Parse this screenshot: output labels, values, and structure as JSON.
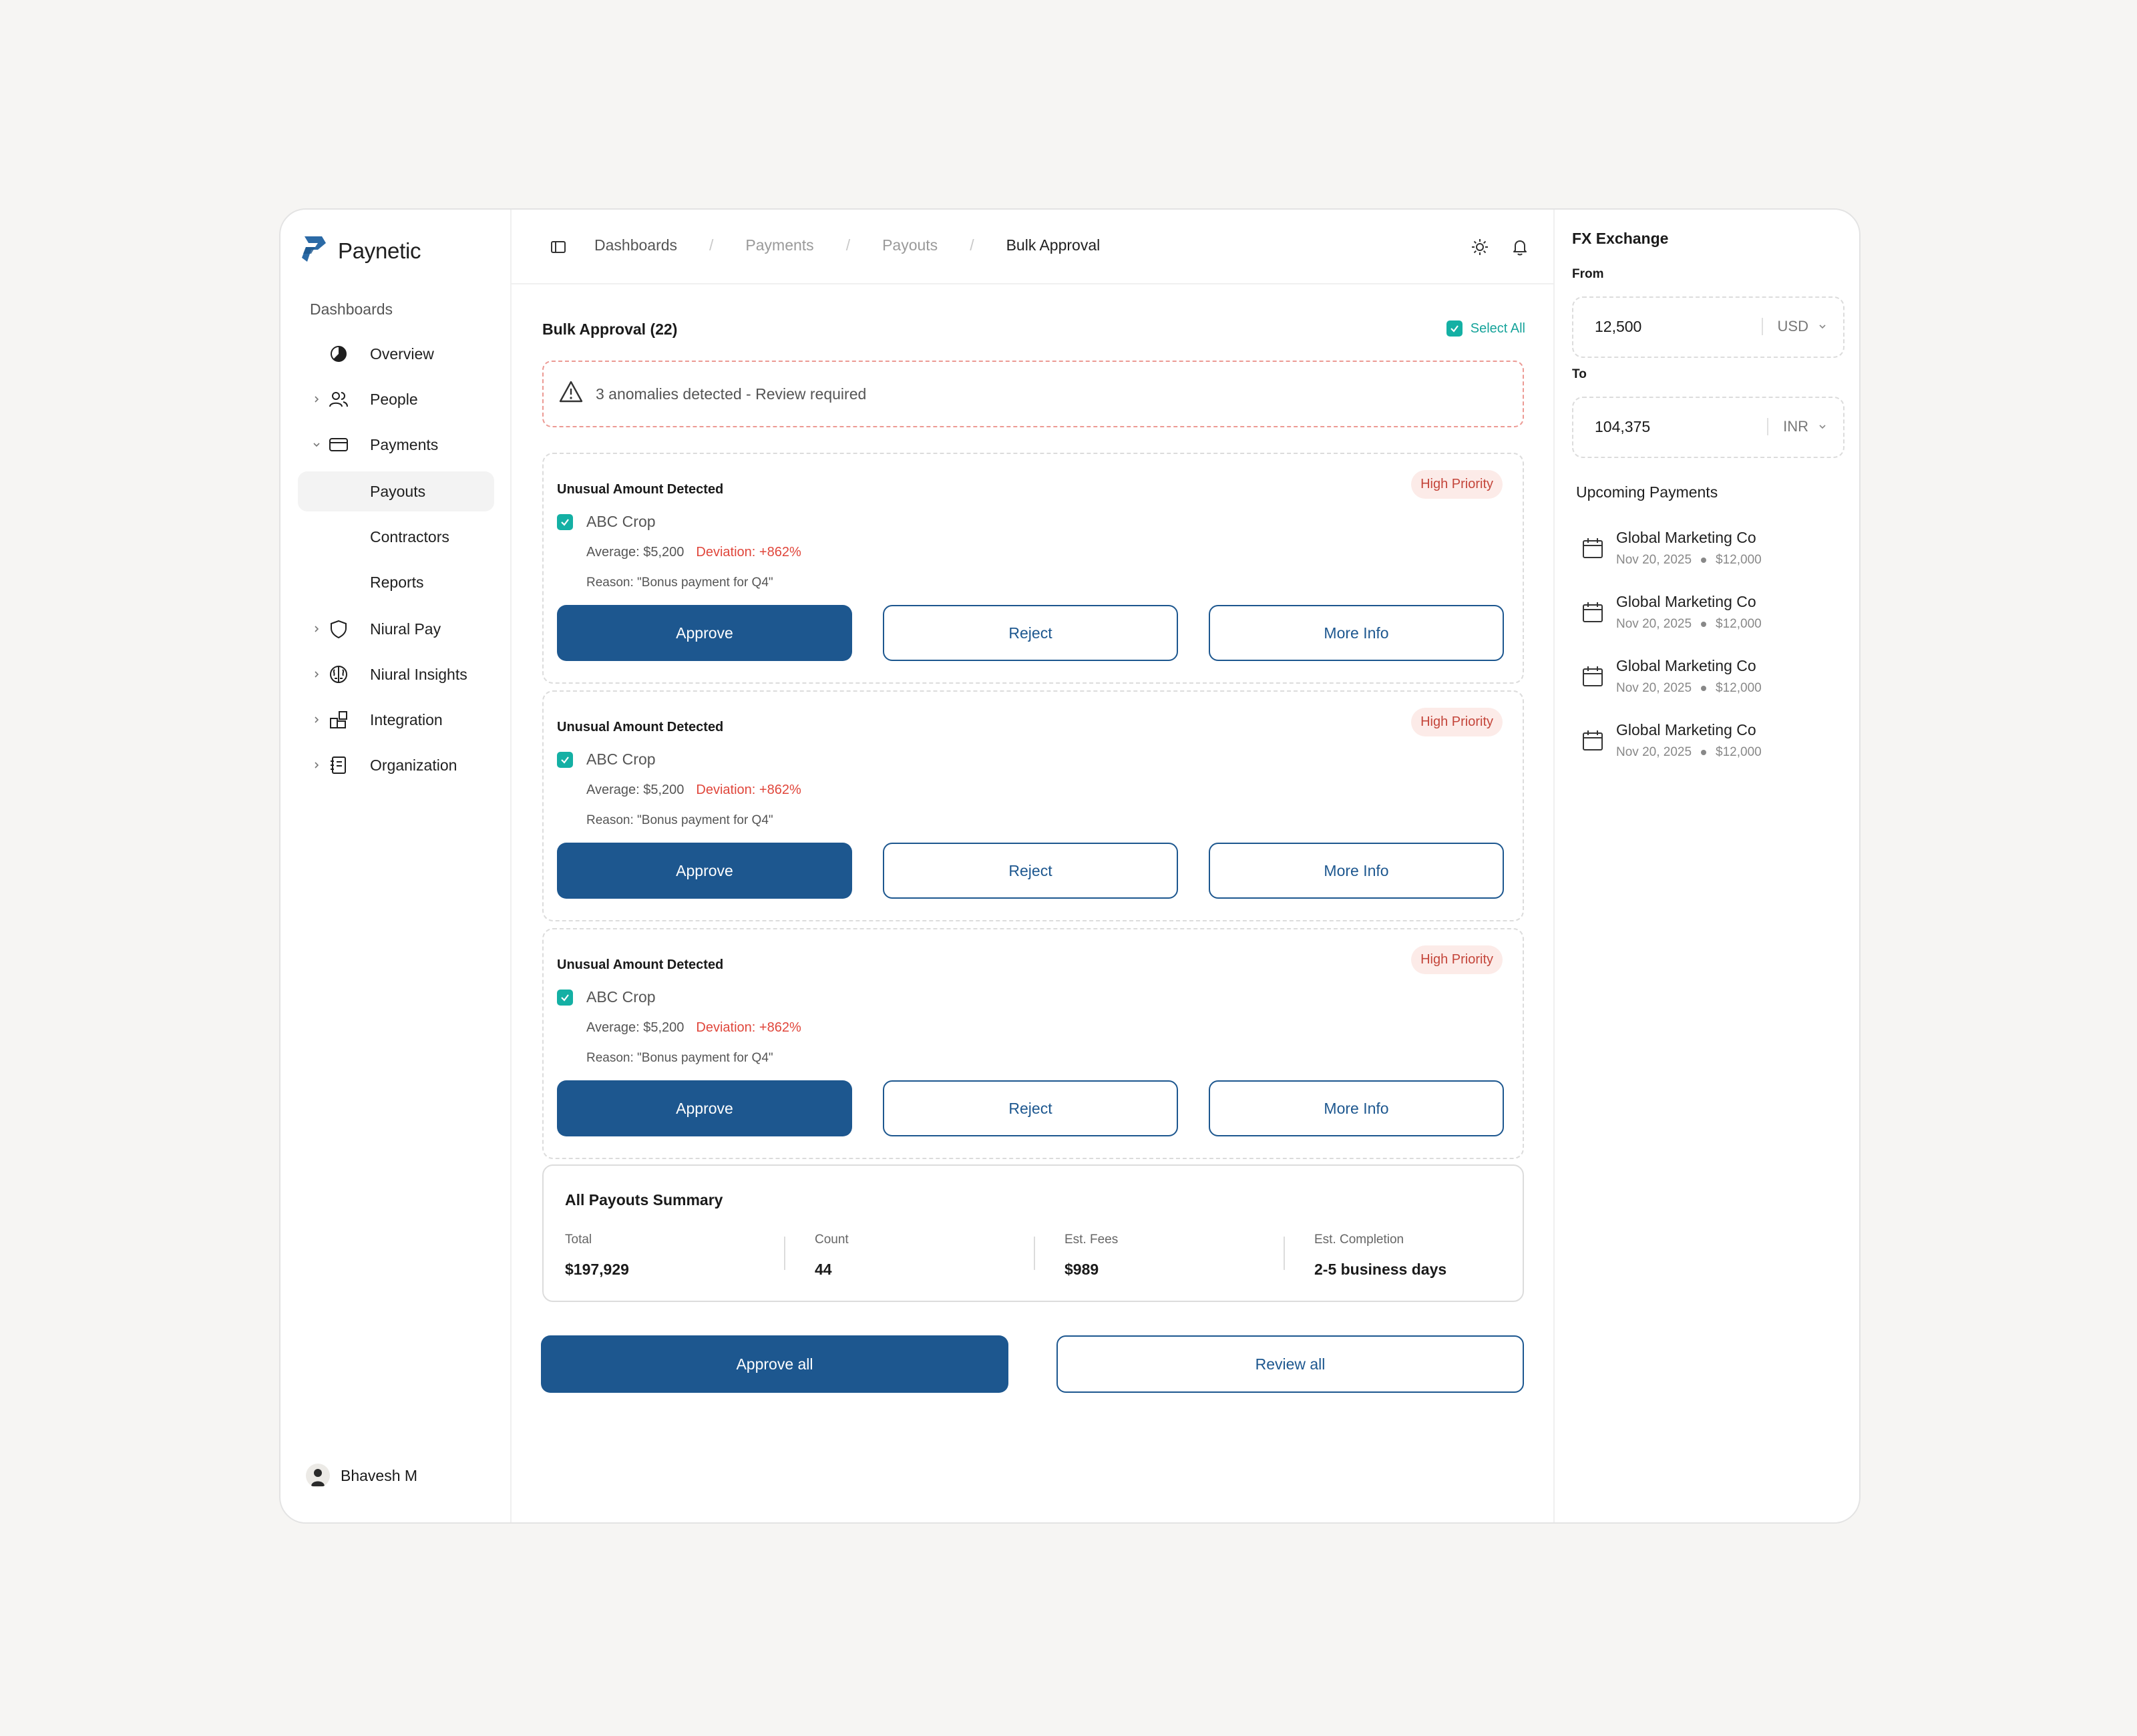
{
  "brand": {
    "name": "Paynetic"
  },
  "sidebar": {
    "section": "Dashboards",
    "items": [
      {
        "label": "Overview"
      },
      {
        "label": "People"
      },
      {
        "label": "Payments"
      },
      {
        "label": "Payouts"
      },
      {
        "label": "Contractors"
      },
      {
        "label": "Reports"
      },
      {
        "label": "Niural Pay"
      },
      {
        "label": "Niural Insights"
      },
      {
        "label": "Integration"
      },
      {
        "label": "Organization"
      }
    ],
    "user": "Bhavesh M"
  },
  "breadcrumb": [
    "Dashboards",
    "Payments",
    "Payouts",
    "Bulk Approval"
  ],
  "bulk": {
    "title": "Bulk Approval (22)",
    "select_all": "Select All",
    "alert": "3 anomalies detected - Review required"
  },
  "cards": [
    {
      "title": "Unusual Amount Detected",
      "badge": "High Priority",
      "vendor": "ABC Crop",
      "average": "Average: $5,200",
      "deviation": "Deviation: +862%",
      "reason": "Reason: \"Bonus payment for Q4\"",
      "approve": "Approve",
      "reject": "Reject",
      "more": "More Info"
    },
    {
      "title": "Unusual Amount Detected",
      "badge": "High Priority",
      "vendor": "ABC Crop",
      "average": "Average: $5,200",
      "deviation": "Deviation: +862%",
      "reason": "Reason: \"Bonus payment for Q4\"",
      "approve": "Approve",
      "reject": "Reject",
      "more": "More Info"
    },
    {
      "title": "Unusual Amount Detected",
      "badge": "High Priority",
      "vendor": "ABC Crop",
      "average": "Average: $5,200",
      "deviation": "Deviation: +862%",
      "reason": "Reason: \"Bonus payment for Q4\"",
      "approve": "Approve",
      "reject": "Reject",
      "more": "More Info"
    }
  ],
  "summary": {
    "title": "All Payouts Summary",
    "stats": [
      {
        "label": "Total",
        "value": "$197,929"
      },
      {
        "label": "Count",
        "value": "44"
      },
      {
        "label": "Est. Fees",
        "value": "$989"
      },
      {
        "label": "Est. Completion",
        "value": "2-5 business days"
      }
    ]
  },
  "actions": {
    "approve_all": "Approve all",
    "review_all": "Review all"
  },
  "fx": {
    "title": "FX Exchange",
    "from_label": "From",
    "from_value": "12,500",
    "from_currency": "USD",
    "to_label": "To",
    "to_value": "104,375",
    "to_currency": "INR"
  },
  "upcoming": {
    "title": "Upcoming Payments",
    "items": [
      {
        "name": "Global Marketing Co",
        "date": "Nov 20, 2025",
        "amount": "$12,000"
      },
      {
        "name": "Global Marketing Co",
        "date": "Nov 20, 2025",
        "amount": "$12,000"
      },
      {
        "name": "Global Marketing Co",
        "date": "Nov 20, 2025",
        "amount": "$12,000"
      },
      {
        "name": "Global Marketing Co",
        "date": "Nov 20, 2025",
        "amount": "$12,000"
      }
    ]
  },
  "colors": {
    "primary": "#1d578f",
    "teal": "#14b0a4",
    "danger": "#e0463b",
    "badge_bg": "#fcebe8"
  }
}
